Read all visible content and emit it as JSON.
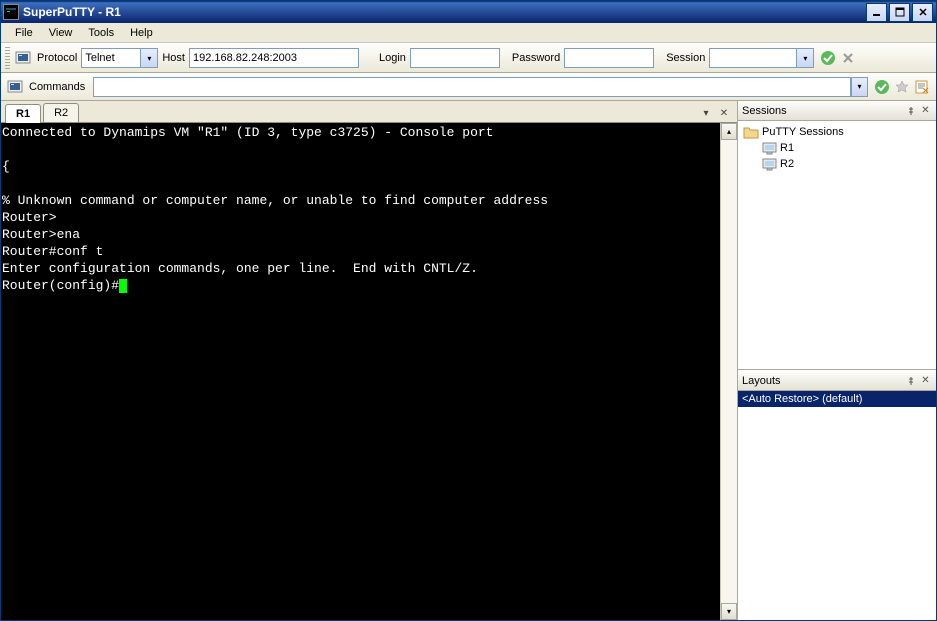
{
  "window": {
    "title": "SuperPuTTY - R1"
  },
  "menu": {
    "items": [
      "File",
      "View",
      "Tools",
      "Help"
    ]
  },
  "toolbar": {
    "protocol_label": "Protocol",
    "protocol_value": "Telnet",
    "host_label": "Host",
    "host_value": "192.168.82.248:2003",
    "login_label": "Login",
    "login_value": "",
    "password_label": "Password",
    "password_value": "",
    "session_label": "Session",
    "session_value": ""
  },
  "commands": {
    "label": "Commands",
    "value": ""
  },
  "tabs": {
    "items": [
      {
        "label": "R1",
        "active": true
      },
      {
        "label": "R2",
        "active": false
      }
    ]
  },
  "terminal": {
    "lines": [
      "Connected to Dynamips VM \"R1\" (ID 3, type c3725) - Console port",
      "",
      "{",
      "",
      "% Unknown command or computer name, or unable to find computer address",
      "Router>",
      "Router>ena",
      "Router#conf t",
      "Enter configuration commands, one per line.  End with CNTL/Z."
    ],
    "prompt_line": "Router(config)#"
  },
  "sessions": {
    "title": "Sessions",
    "root": "PuTTY Sessions",
    "items": [
      "R1",
      "R2"
    ]
  },
  "layouts": {
    "title": "Layouts",
    "items": [
      {
        "label": "<Auto Restore> (default)",
        "selected": true
      }
    ]
  }
}
